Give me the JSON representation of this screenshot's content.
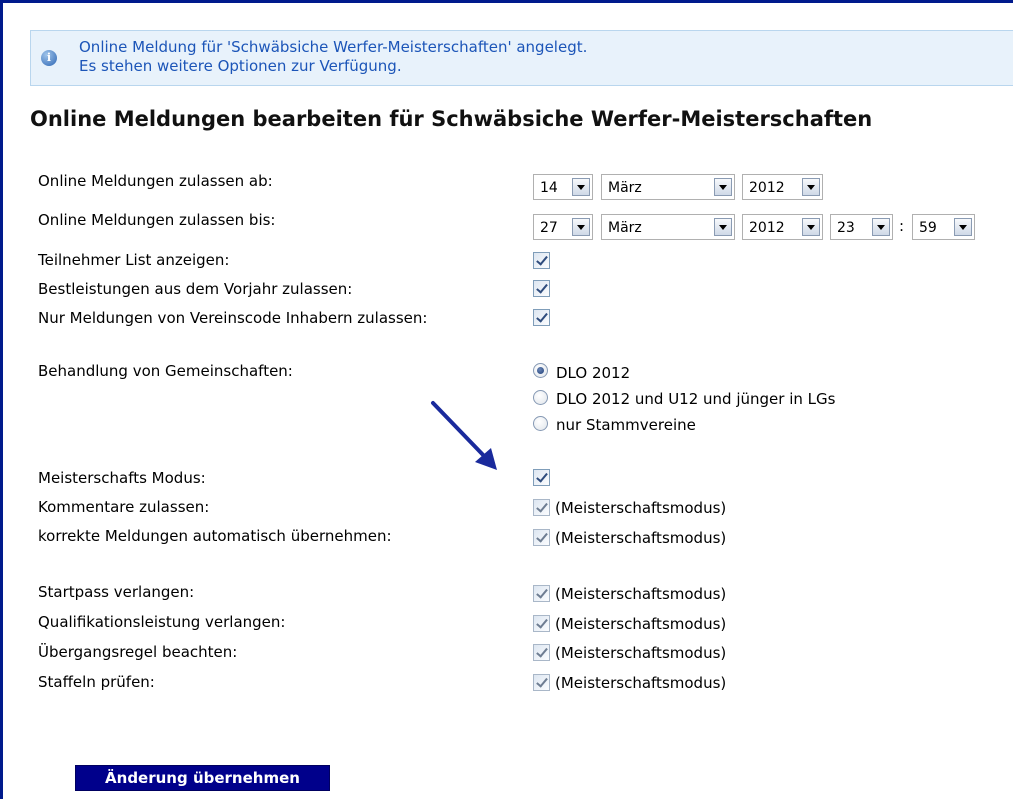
{
  "info": {
    "line1": "Online Meldung für 'Schwäbsiche Werfer-Meisterschaften' angelegt.",
    "line2": "Es stehen weitere Optionen zur Verfügung."
  },
  "title": "Online Meldungen bearbeiten für Schwäbsiche Werfer-Meisterschaften",
  "date_from": {
    "label": "Online Meldungen zulassen ab:",
    "day": "14",
    "month": "März",
    "year": "2012"
  },
  "date_to": {
    "label": "Online Meldungen zulassen bis:",
    "day": "27",
    "month": "März",
    "year": "2012",
    "hour": "23",
    "sep": ":",
    "minute": "59"
  },
  "options": {
    "teilnehmer": {
      "label": "Teilnehmer List anzeigen:",
      "checked": true
    },
    "bestleistungen": {
      "label": "Bestleistungen aus dem Vorjahr zulassen:",
      "checked": true
    },
    "vereinscode": {
      "label": "Nur Meldungen von Vereinscode Inhabern zulassen:",
      "checked": true
    }
  },
  "gemeinschaften": {
    "label": "Behandlung von Gemeinschaften:",
    "options": [
      "DLO 2012",
      "DLO 2012 und U12 und jünger in LGs",
      "nur Stammvereine"
    ],
    "selected": "DLO 2012"
  },
  "modus": {
    "meisterschafts": {
      "label": "Meisterschafts Modus:",
      "checked": true
    },
    "kommentare": {
      "label": "Kommentare zulassen:",
      "checked": true,
      "note": "(Meisterschaftsmodus)"
    },
    "korrekte": {
      "label": "korrekte Meldungen automatisch übernehmen:",
      "checked": true,
      "note": "(Meisterschaftsmodus)"
    },
    "startpass": {
      "label": "Startpass verlangen:",
      "checked": true,
      "note": "(Meisterschaftsmodus)"
    },
    "qualifikation": {
      "label": "Qualifikationsleistung verlangen:",
      "checked": true,
      "note": "(Meisterschaftsmodus)"
    },
    "uebergang": {
      "label": "Übergangsregel beachten:",
      "checked": true,
      "note": "(Meisterschaftsmodus)"
    },
    "staffeln": {
      "label": "Staffeln prüfen:",
      "checked": true,
      "note": "(Meisterschaftsmodus)"
    }
  },
  "submit_label": "Änderung übernehmen",
  "colors": {
    "frame": "#001a8c",
    "info_text": "#1c55b8",
    "submit_bg": "#00008b",
    "arrow": "#1a2a9c"
  }
}
